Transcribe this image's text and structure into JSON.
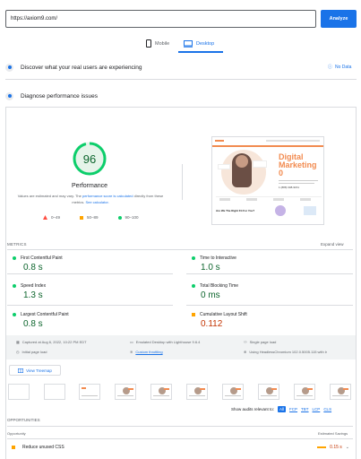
{
  "search": {
    "url_value": "https://axiom9.com/",
    "analyze_label": "Analyze"
  },
  "device_tabs": [
    {
      "label": "Mobile"
    },
    {
      "label": "Desktop"
    }
  ],
  "field_data": {
    "label": "Discover what your real users are experiencing",
    "no_data": "No Data"
  },
  "lab_data": {
    "label": "Diagnose performance issues"
  },
  "performance": {
    "score": "96",
    "label": "Performance",
    "note_pre": "Values are estimated and may vary. The ",
    "note_link1": "performance score is calculated",
    "note_mid": " directly from these metrics. ",
    "note_link2": "See calculator.",
    "legend": [
      {
        "label": "0–49"
      },
      {
        "label": "50–89"
      },
      {
        "label": "90–100"
      }
    ]
  },
  "preview": {
    "hero_title_1": "Digital",
    "hero_title_2": "Marketing",
    "hero_title_3": "0",
    "phone": "1 (888) 308-9151",
    "footer_text": "Are We The Right Fit For You?"
  },
  "metrics": {
    "header": "METRICS",
    "expand": "Expand view",
    "items": [
      {
        "label": "First Contentful Paint",
        "value": "0.8 s"
      },
      {
        "label": "Time to Interactive",
        "value": "1.0 s"
      },
      {
        "label": "Speed Index",
        "value": "1.3 s"
      },
      {
        "label": "Total Blocking Time",
        "value": "0 ms"
      },
      {
        "label": "Largest Contentful Paint",
        "value": "0.8 s"
      },
      {
        "label": "Cumulative Layout Shift",
        "value": "0.112"
      }
    ]
  },
  "info": {
    "captured": "Captured at Aug 6, 2022, 10:22 PM EDT",
    "initial_load": "Initial page load",
    "emulated": "Emulated Desktop with Lighthouse 9.6.4",
    "throttling": "Custom throttling",
    "single_load": "Single page load",
    "browser": "Using HeadlessChromium 102.0.5005.115 with lr"
  },
  "treemap": {
    "label": "View Treemap"
  },
  "audits": {
    "show_label": "Show audits relevant to:",
    "filters": [
      "All",
      "FCP",
      "TBT",
      "LCP",
      "CLS"
    ]
  },
  "opportunities": {
    "header": "OPPORTUNITIES",
    "col_opportunity": "Opportunity",
    "col_savings": "Estimated Savings",
    "items": [
      {
        "label": "Reduce unused CSS",
        "savings": "0.15 s"
      }
    ]
  },
  "colors": {
    "accent": "#1a73e8",
    "good": "#0cce6b",
    "average": "#ffa400",
    "poor": "#ff4e42",
    "brand_orange": "#f28b50"
  }
}
